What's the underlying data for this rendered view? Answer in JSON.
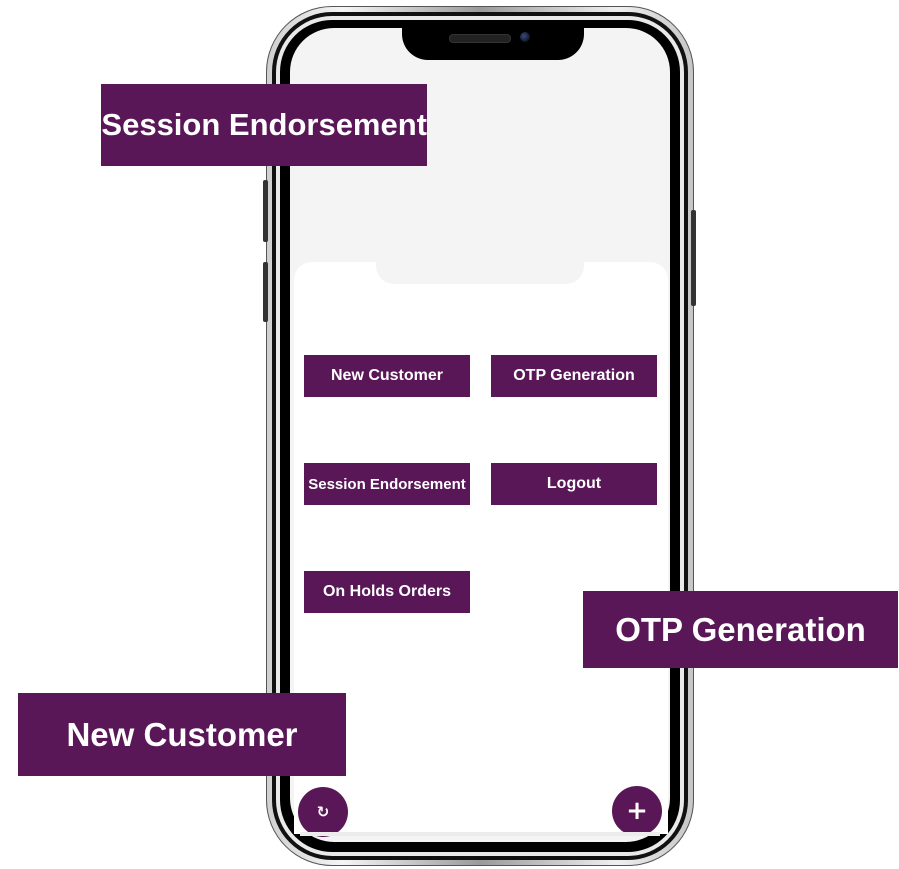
{
  "colors": {
    "accent": "#5a1758",
    "screen_background": "#f4f4f4",
    "card_background": "#ffffff",
    "button_text": "#ffffff"
  },
  "menu": {
    "new_customer": "New Customer",
    "otp_generation": "OTP Generation",
    "session_endorsement": "Session Endorsement",
    "logout": "Logout",
    "on_holds_orders": "On Holds Orders"
  },
  "fabs": {
    "refresh_icon": "refresh-icon",
    "refresh_glyph": "↻",
    "add_icon": "plus-icon",
    "add_glyph": "+"
  },
  "callouts": {
    "session_endorsement": "Session Endorsement",
    "otp_generation": "OTP Generation",
    "new_customer": "New Customer"
  }
}
